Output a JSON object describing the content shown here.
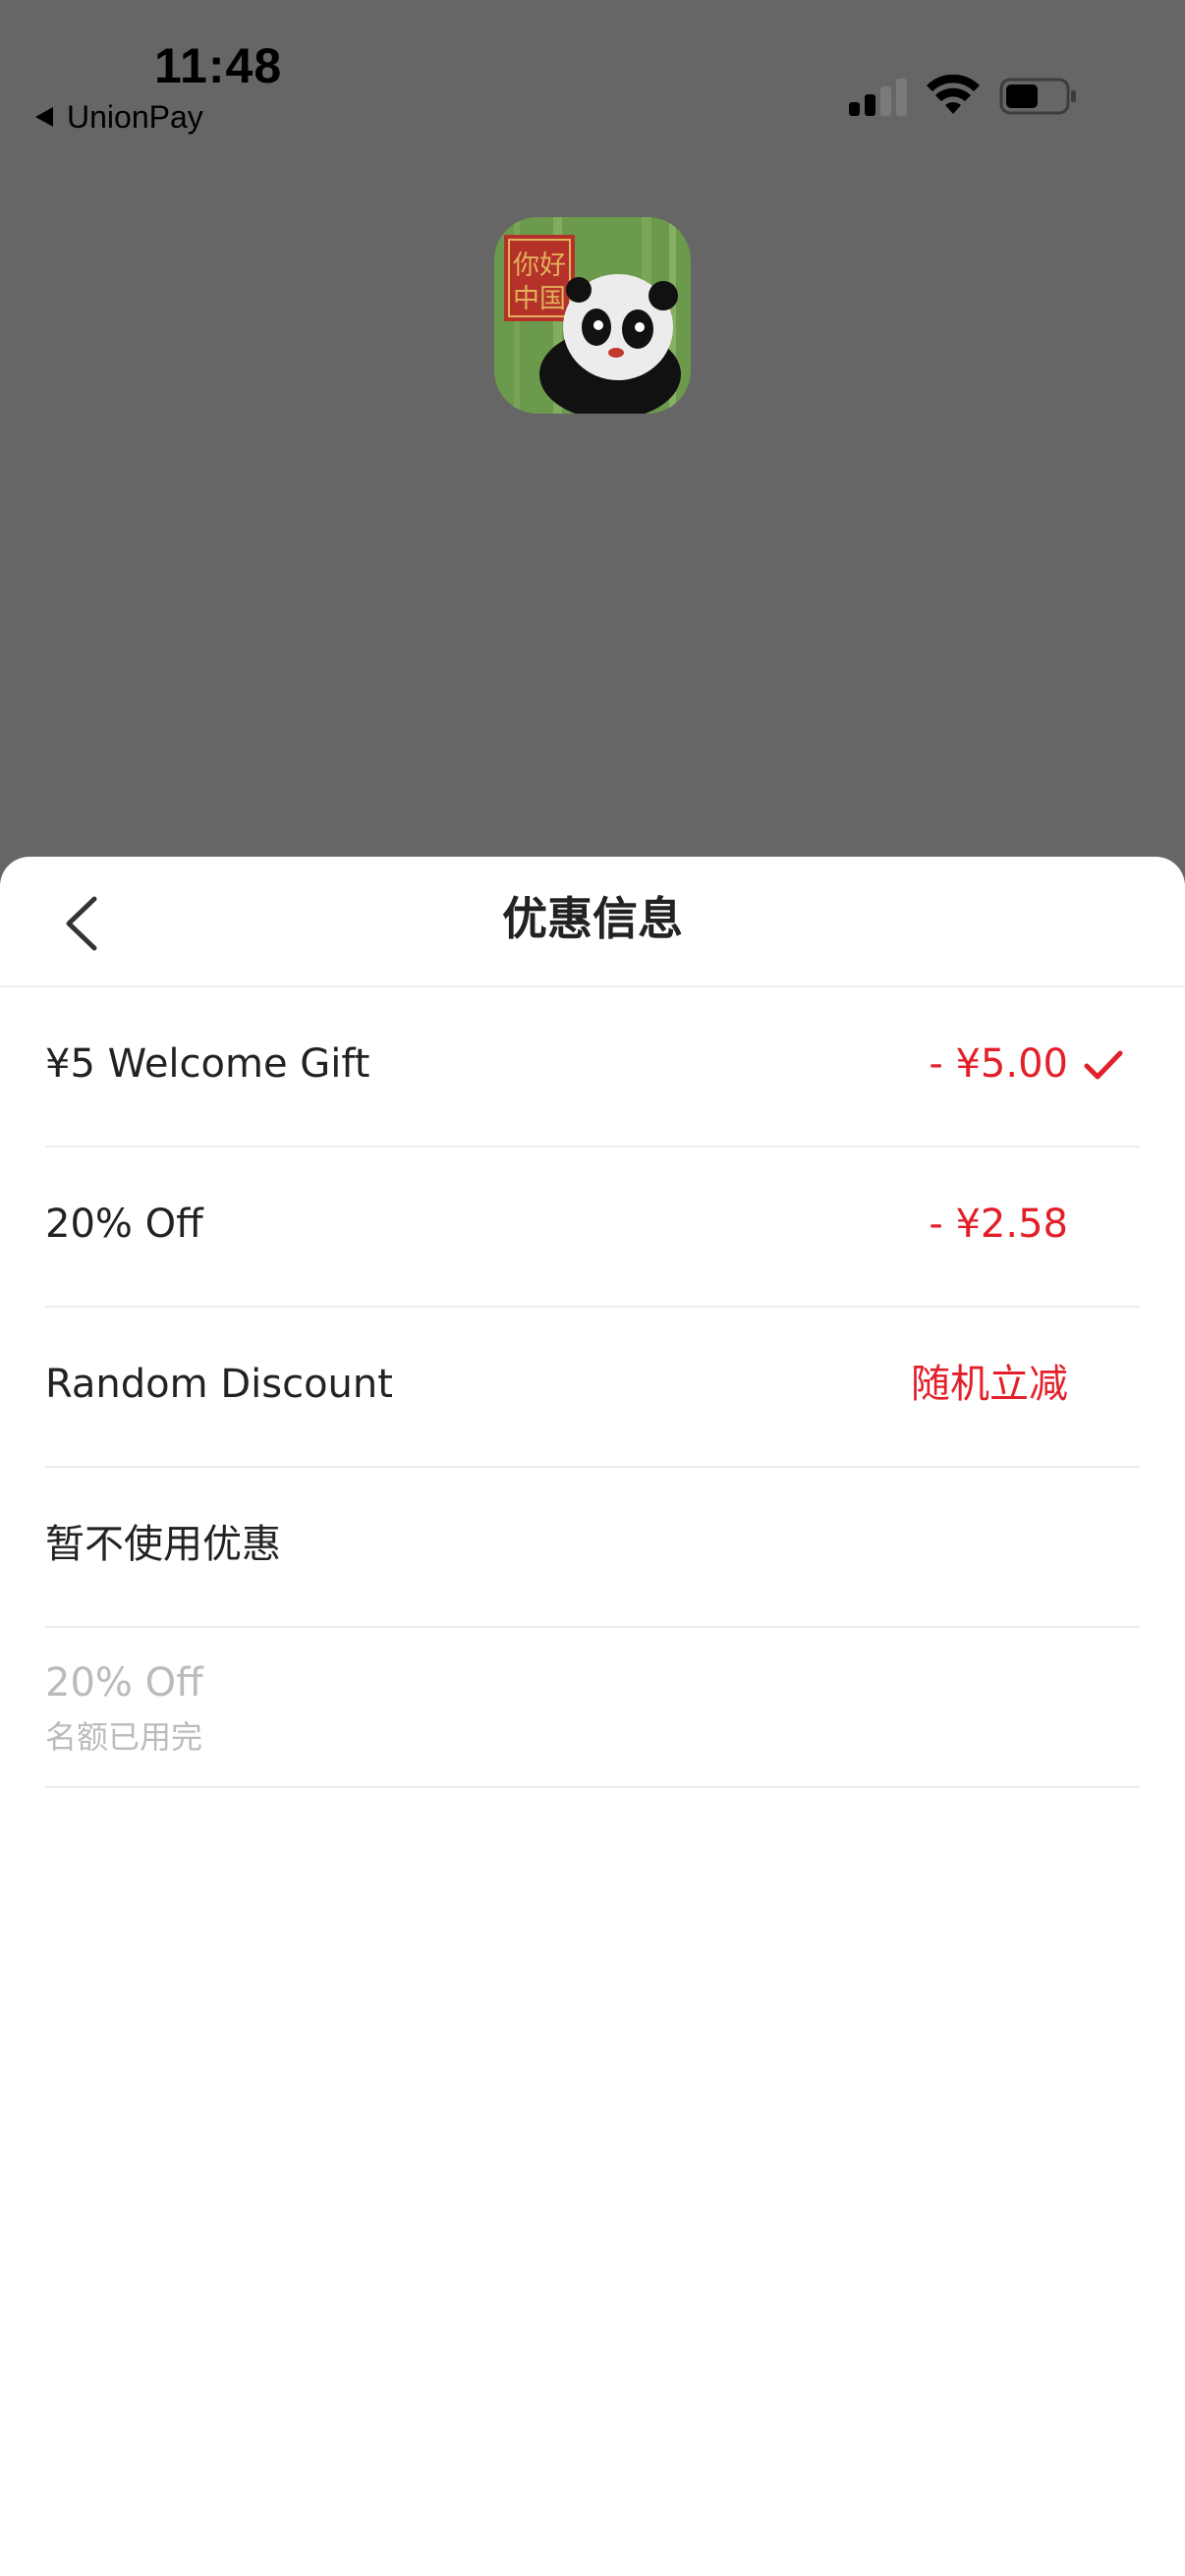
{
  "status_bar": {
    "time": "11:48",
    "back_app": "UnionPay"
  },
  "app_icon": {
    "name": "panda-app-icon",
    "stamp_text": "你好中国"
  },
  "sheet": {
    "title": "优惠信息",
    "back_icon": "chevron-left-icon"
  },
  "discounts": [
    {
      "label": "¥5 Welcome Gift",
      "value": "- ¥5.00",
      "selected": true
    },
    {
      "label": "20% Off",
      "value": "- ¥2.58",
      "selected": false
    },
    {
      "label": "Random Discount",
      "value": "随机立减",
      "selected": false
    },
    {
      "label": "暂不使用优惠",
      "value": "",
      "selected": false
    }
  ],
  "unavailable": [
    {
      "label": "20% Off",
      "note": "名额已用完"
    }
  ],
  "colors": {
    "accent_red": "#e3202a",
    "text_primary": "#222222",
    "text_disabled": "#bbbbbb",
    "backdrop": "#666666",
    "divider": "#ececec"
  }
}
